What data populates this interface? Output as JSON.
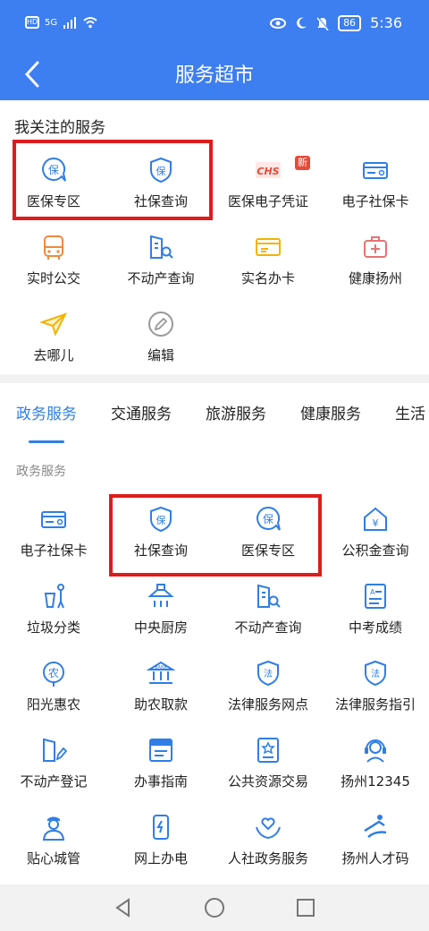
{
  "status": {
    "left_hd": "HD",
    "left_net": "5G",
    "battery": "86",
    "time": "5:36"
  },
  "header": {
    "title": "服务超市"
  },
  "favorites": {
    "heading": "我关注的服务",
    "items": [
      {
        "label": "医保专区",
        "icon": "yibao-icon"
      },
      {
        "label": "社保查询",
        "icon": "shebao-shield-icon"
      },
      {
        "label": "医保电子凭证",
        "icon": "chs-icon"
      },
      {
        "label": "电子社保卡",
        "icon": "card-icon"
      },
      {
        "label": "实时公交",
        "icon": "bus-icon"
      },
      {
        "label": "不动产查询",
        "icon": "building-search-icon"
      },
      {
        "label": "实名办卡",
        "icon": "idcard-icon"
      },
      {
        "label": "健康扬州",
        "icon": "medkit-icon"
      },
      {
        "label": "去哪儿",
        "icon": "paper-plane-icon"
      },
      {
        "label": "编辑",
        "icon": "edit-pencil-icon"
      }
    ],
    "new_badge": "新"
  },
  "category_tabs": [
    "政务服务",
    "交通服务",
    "旅游服务",
    "健康服务",
    "生活"
  ],
  "gov": {
    "sub_heading": "政务服务",
    "items": [
      {
        "label": "电子社保卡"
      },
      {
        "label": "社保查询"
      },
      {
        "label": "医保专区"
      },
      {
        "label": "公积金查询"
      },
      {
        "label": "垃圾分类"
      },
      {
        "label": "中央厨房"
      },
      {
        "label": "不动产查询"
      },
      {
        "label": "中考成绩"
      },
      {
        "label": "阳光惠农"
      },
      {
        "label": "助农取款"
      },
      {
        "label": "法律服务网点"
      },
      {
        "label": "法律服务指引"
      },
      {
        "label": "不动产登记"
      },
      {
        "label": "办事指南"
      },
      {
        "label": "公共资源交易"
      },
      {
        "label": "扬州12345"
      },
      {
        "label": "贴心城管"
      },
      {
        "label": "网上办电"
      },
      {
        "label": "人社政务服务"
      },
      {
        "label": "扬州人才码"
      }
    ]
  },
  "icon_glyphs": {
    "bao": "保",
    "nong": "农",
    "fa": "法",
    "yen": "¥"
  },
  "colors": {
    "primary": "#3d7ef0",
    "icon_blue": "#2f7ee6",
    "red_box": "#e01b1b",
    "orange": "#f08a3c",
    "yellow": "#f3b300"
  }
}
